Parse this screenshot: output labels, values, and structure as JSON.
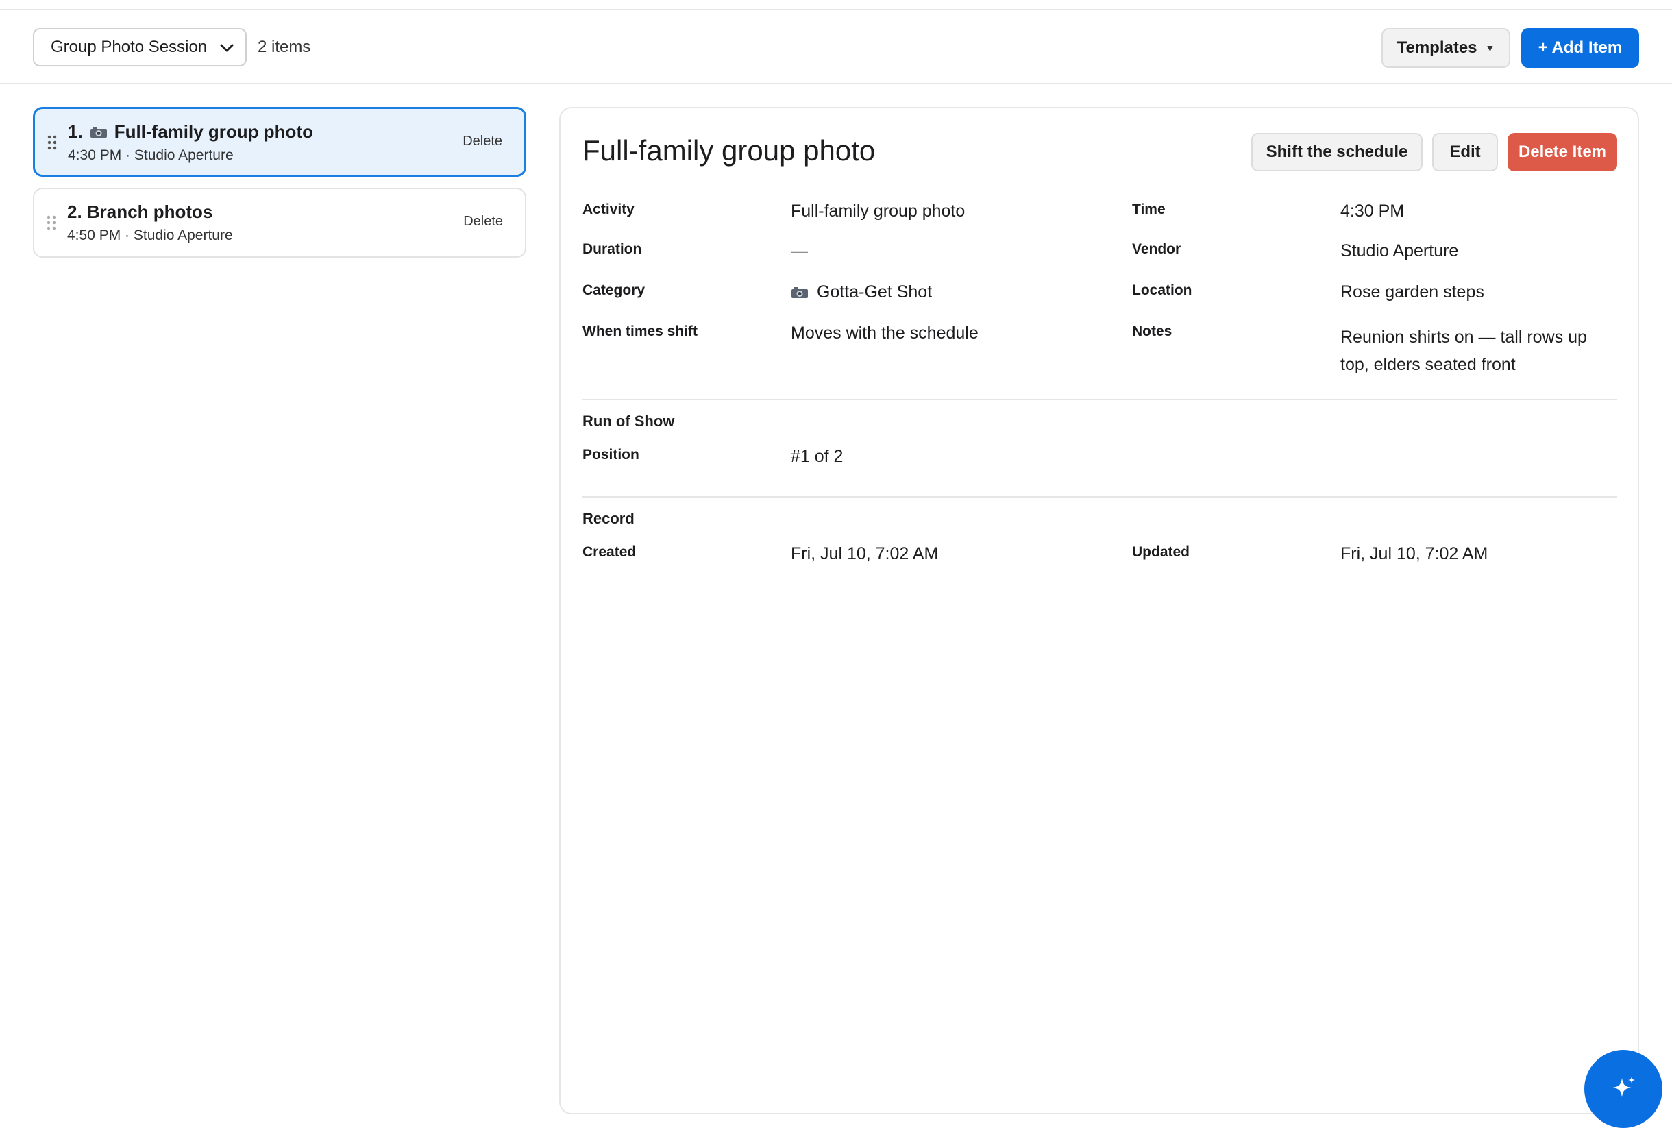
{
  "toolbar": {
    "session_select": "Group Photo Session",
    "item_count": "2 items",
    "templates_label": "Templates",
    "add_label": "+ Add Item"
  },
  "list": {
    "items": [
      {
        "title": "1.  Full-family group photo",
        "number": "1.",
        "name": "Full-family group photo",
        "subtitle": "4:30 PM · Studio Aperture",
        "delete": "Delete",
        "selected": true,
        "icon": "camera-icon"
      },
      {
        "title": "2. Branch photos",
        "subtitle": "4:50 PM · Studio Aperture",
        "delete": "Delete",
        "selected": false
      }
    ]
  },
  "detail": {
    "title": "Full-family group photo",
    "shift_label": "Shift the schedule",
    "edit_label": "Edit",
    "delete_label": "Delete Item",
    "fields": {
      "activity_label": "Activity",
      "activity": "Full-family group photo",
      "time_label": "Time",
      "time": "4:30 PM",
      "duration_label": "Duration",
      "duration": "—",
      "vendor_label": "Vendor",
      "vendor": "Studio Aperture",
      "category_label": "Category",
      "category": "Gotta-Get Shot",
      "location_label": "Location",
      "location": "Rose garden steps",
      "shift_label": "When times shift",
      "shift": "Moves with the schedule",
      "notes_label": "Notes",
      "notes_line1": "Reunion shirts on — tall rows up",
      "notes_line2": "top, elders seated front"
    },
    "run_of_show": {
      "heading": "Run of Show",
      "position_label": "Position",
      "position": "#1 of 2"
    },
    "record": {
      "heading": "Record",
      "created_label": "Created",
      "created": "Fri, Jul 10, 7:02 AM",
      "updated_label": "Updated",
      "updated": "Fri, Jul 10, 7:02 AM"
    }
  },
  "colors": {
    "accent": "#0a6fe0",
    "danger": "#de5a48",
    "selected_bg": "#e7f2fc"
  },
  "fab": {
    "icon": "sparkle-icon"
  }
}
